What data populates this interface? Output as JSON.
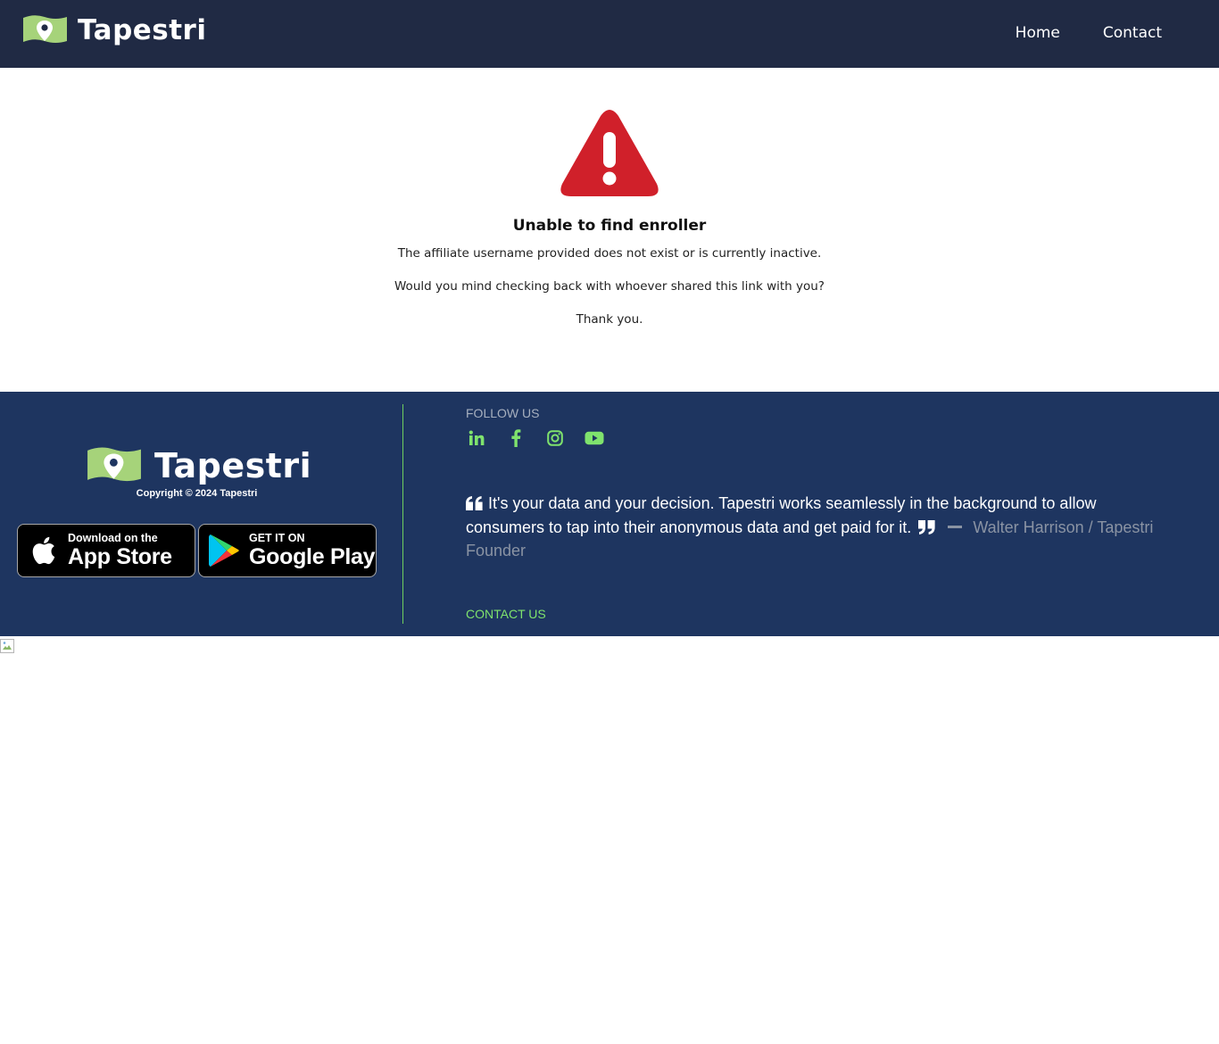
{
  "header": {
    "brand": "Tapestri",
    "nav": [
      {
        "label": "Home"
      },
      {
        "label": "Contact"
      }
    ]
  },
  "main": {
    "icon": "warning-triangle-icon",
    "title": "Unable to find enroller",
    "message1": "The affiliate username provided does not exist or is currently inactive.",
    "message2": "Would you mind checking back with whoever shared this link with you?",
    "message3": "Thank you."
  },
  "footer": {
    "brand": "Tapestri",
    "copyright": "Copyright © 2024 Tapestri",
    "app_store": {
      "small": "Download on the",
      "big": "App Store"
    },
    "google_play": {
      "small": "GET IT ON",
      "big": "Google Play"
    },
    "follow_label": "FOLLOW US",
    "social": [
      "linkedin-icon",
      "facebook-icon",
      "instagram-icon",
      "youtube-icon"
    ],
    "quote": "It's your data and your decision. Tapestri works seamlessly in the background to allow consumers to tap into their anonymous data and get paid for it.",
    "author": "Walter Harrison / Tapestri Founder",
    "contact_label": "CONTACT US"
  },
  "colors": {
    "header_bg": "#202a44",
    "footer_bg": "#1e3560",
    "accent_green": "#7fe36d",
    "warning_red": "#d0202a"
  }
}
